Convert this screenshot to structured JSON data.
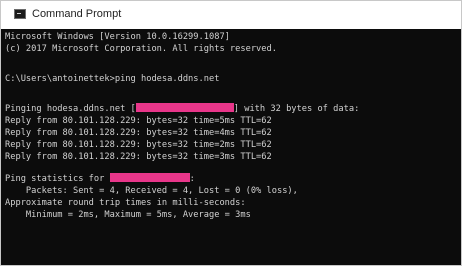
{
  "window": {
    "title": "Command Prompt",
    "icon": "cmd-icon"
  },
  "console": {
    "lines": [
      "Microsoft Windows [Version 10.0.16299.1087]",
      "(c) 2017 Microsoft Corporation. All rights reserved.",
      "",
      "C:\\Users\\antoinettek>ping hodesa.ddns.net",
      "",
      "Pinging hodesa.ddns.net [",
      "] with 32 bytes of data:",
      "Reply from 80.101.128.229: bytes=32 time=5ms TTL=62",
      "Reply from 80.101.128.229: bytes=32 time=4ms TTL=62",
      "Reply from 80.101.128.229: bytes=32 time=2ms TTL=62",
      "Reply from 80.101.128.229: bytes=32 time=3ms TTL=62",
      "",
      "Ping statistics for ",
      ":",
      "    Packets: Sent = 4, Received = 4, Lost = 0 (0% loss),",
      "Approximate round trip times in milli-seconds:",
      "    Minimum = 2ms, Maximum = 5ms, Average = 3ms"
    ],
    "redaction_color": "#e8368a",
    "text_color": "#d2d2d2",
    "background_color": "#0c0c0c"
  }
}
